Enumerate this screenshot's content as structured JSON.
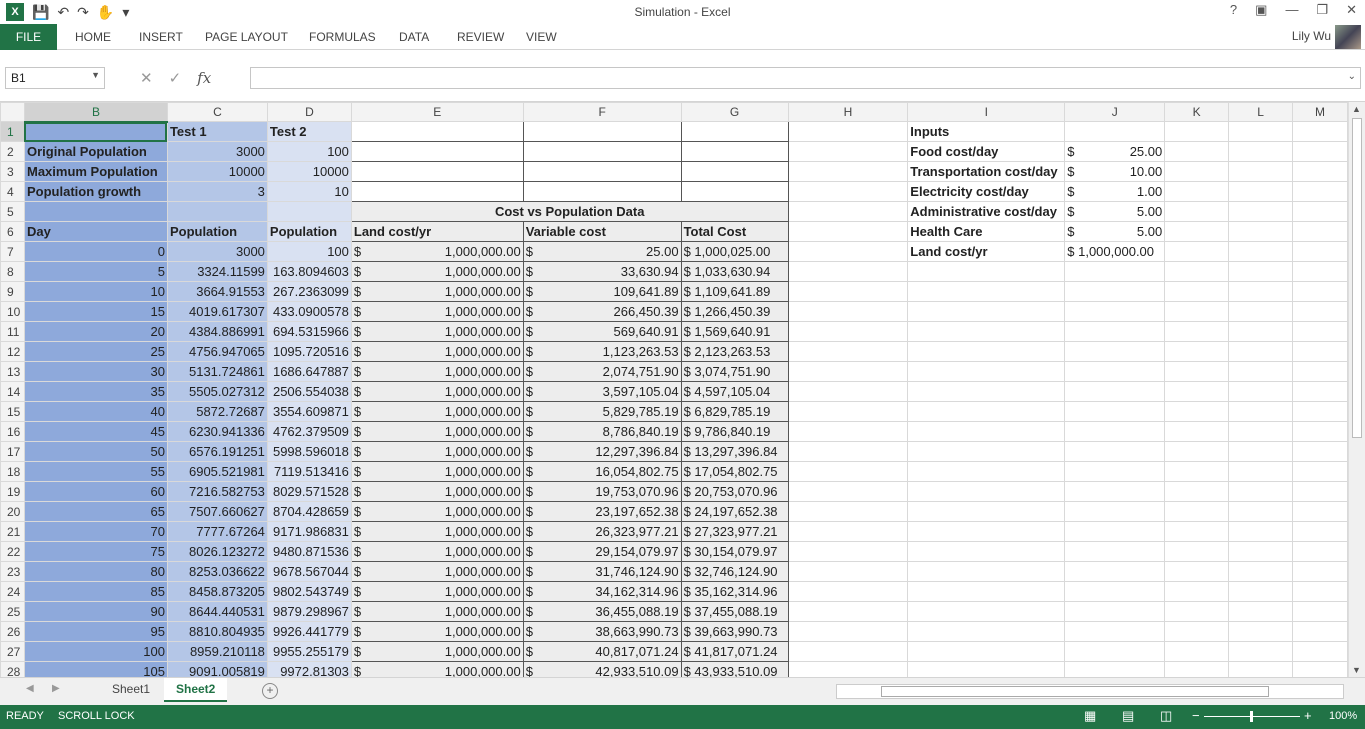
{
  "window": {
    "title": "Simulation - Excel",
    "user": "Lily Wu"
  },
  "ribbon": {
    "file": "FILE",
    "tabs": [
      "HOME",
      "INSERT",
      "PAGE LAYOUT",
      "FORMULAS",
      "DATA",
      "REVIEW",
      "VIEW"
    ]
  },
  "formula_bar": {
    "name_box": "B1",
    "formula": ""
  },
  "columns": [
    "B",
    "C",
    "D",
    "E",
    "F",
    "G",
    "H",
    "I",
    "J",
    "K",
    "L",
    "M"
  ],
  "header_rows": {
    "r1": {
      "B": "",
      "C": "Test 1",
      "D": "Test 2"
    },
    "r2": {
      "B": "Original Population",
      "C": "3000",
      "D": "100"
    },
    "r3": {
      "B": "Maximum Population",
      "C": "10000",
      "D": "10000"
    },
    "r4": {
      "B": "Population growth",
      "C": "3",
      "D": "10"
    },
    "r5": {
      "E": "Cost vs Population Data"
    },
    "r6": {
      "B": "Day",
      "C": "Population",
      "D": "Population",
      "E": "Land cost/yr",
      "F": "Variable cost",
      "G": "Total Cost"
    }
  },
  "inputs": {
    "title": "Inputs",
    "items": [
      {
        "label": "Food cost/day",
        "cur": "$",
        "value": "25.00"
      },
      {
        "label": "Transportation cost/day",
        "cur": "$",
        "value": "10.00"
      },
      {
        "label": "Electricity cost/day",
        "cur": "$",
        "value": "1.00"
      },
      {
        "label": "Administrative cost/day",
        "cur": "$",
        "value": "5.00"
      },
      {
        "label": "Health Care",
        "cur": "$",
        "value": "5.00"
      },
      {
        "label": "Land cost/yr",
        "cur": "",
        "value": "$ 1,000,000.00"
      }
    ]
  },
  "data_rows": [
    {
      "row": "7",
      "day": "0",
      "p1": "3000",
      "p2": "100",
      "land": "1,000,000.00",
      "var": "25.00",
      "total": "$  1,000,025.00"
    },
    {
      "row": "8",
      "day": "5",
      "p1": "3324.11599",
      "p2": "163.8094603",
      "land": "1,000,000.00",
      "var": "33,630.94",
      "total": "$  1,033,630.94"
    },
    {
      "row": "9",
      "day": "10",
      "p1": "3664.91553",
      "p2": "267.2363099",
      "land": "1,000,000.00",
      "var": "109,641.89",
      "total": "$  1,109,641.89"
    },
    {
      "row": "10",
      "day": "15",
      "p1": "4019.617307",
      "p2": "433.0900578",
      "land": "1,000,000.00",
      "var": "266,450.39",
      "total": "$  1,266,450.39"
    },
    {
      "row": "11",
      "day": "20",
      "p1": "4384.886991",
      "p2": "694.5315966",
      "land": "1,000,000.00",
      "var": "569,640.91",
      "total": "$  1,569,640.91"
    },
    {
      "row": "12",
      "day": "25",
      "p1": "4756.947065",
      "p2": "1095.720516",
      "land": "1,000,000.00",
      "var": "1,123,263.53",
      "total": "$  2,123,263.53"
    },
    {
      "row": "13",
      "day": "30",
      "p1": "5131.724861",
      "p2": "1686.647887",
      "land": "1,000,000.00",
      "var": "2,074,751.90",
      "total": "$  3,074,751.90"
    },
    {
      "row": "14",
      "day": "35",
      "p1": "5505.027312",
      "p2": "2506.554038",
      "land": "1,000,000.00",
      "var": "3,597,105.04",
      "total": "$  4,597,105.04"
    },
    {
      "row": "15",
      "day": "40",
      "p1": "5872.72687",
      "p2": "3554.609871",
      "land": "1,000,000.00",
      "var": "5,829,785.19",
      "total": "$  6,829,785.19"
    },
    {
      "row": "16",
      "day": "45",
      "p1": "6230.941336",
      "p2": "4762.379509",
      "land": "1,000,000.00",
      "var": "8,786,840.19",
      "total": "$  9,786,840.19"
    },
    {
      "row": "17",
      "day": "50",
      "p1": "6576.191251",
      "p2": "5998.596018",
      "land": "1,000,000.00",
      "var": "12,297,396.84",
      "total": "$ 13,297,396.84"
    },
    {
      "row": "18",
      "day": "55",
      "p1": "6905.521981",
      "p2": "7119.513416",
      "land": "1,000,000.00",
      "var": "16,054,802.75",
      "total": "$ 17,054,802.75"
    },
    {
      "row": "19",
      "day": "60",
      "p1": "7216.582753",
      "p2": "8029.571528",
      "land": "1,000,000.00",
      "var": "19,753,070.96",
      "total": "$ 20,753,070.96"
    },
    {
      "row": "20",
      "day": "65",
      "p1": "7507.660627",
      "p2": "8704.428659",
      "land": "1,000,000.00",
      "var": "23,197,652.38",
      "total": "$ 24,197,652.38"
    },
    {
      "row": "21",
      "day": "70",
      "p1": "7777.67264",
      "p2": "9171.986831",
      "land": "1,000,000.00",
      "var": "26,323,977.21",
      "total": "$ 27,323,977.21"
    },
    {
      "row": "22",
      "day": "75",
      "p1": "8026.123272",
      "p2": "9480.871536",
      "land": "1,000,000.00",
      "var": "29,154,079.97",
      "total": "$ 30,154,079.97"
    },
    {
      "row": "23",
      "day": "80",
      "p1": "8253.036622",
      "p2": "9678.567044",
      "land": "1,000,000.00",
      "var": "31,746,124.90",
      "total": "$ 32,746,124.90"
    },
    {
      "row": "24",
      "day": "85",
      "p1": "8458.873205",
      "p2": "9802.543749",
      "land": "1,000,000.00",
      "var": "34,162,314.96",
      "total": "$ 35,162,314.96"
    },
    {
      "row": "25",
      "day": "90",
      "p1": "8644.440531",
      "p2": "9879.298967",
      "land": "1,000,000.00",
      "var": "36,455,088.19",
      "total": "$ 37,455,088.19"
    },
    {
      "row": "26",
      "day": "95",
      "p1": "8810.804935",
      "p2": "9926.441779",
      "land": "1,000,000.00",
      "var": "38,663,990.73",
      "total": "$ 39,663,990.73"
    },
    {
      "row": "27",
      "day": "100",
      "p1": "8959.210118",
      "p2": "9955.255179",
      "land": "1,000,000.00",
      "var": "40,817,071.24",
      "total": "$ 41,817,071.24"
    },
    {
      "row": "28",
      "day": "105",
      "p1": "9091.005819",
      "p2": "9972.81303",
      "land": "1,000,000.00",
      "var": "42,933,510.09",
      "total": "$ 43,933,510.09"
    }
  ],
  "sheets": [
    "Sheet1",
    "Sheet2"
  ],
  "active_sheet": "Sheet2",
  "status": {
    "ready": "READY",
    "scroll_lock": "SCROLL LOCK",
    "zoom": "100%"
  },
  "colors": {
    "accent": "#217346",
    "colB": "#8ea9db",
    "colC": "#b4c6e7",
    "colD": "#d9e1f2"
  }
}
